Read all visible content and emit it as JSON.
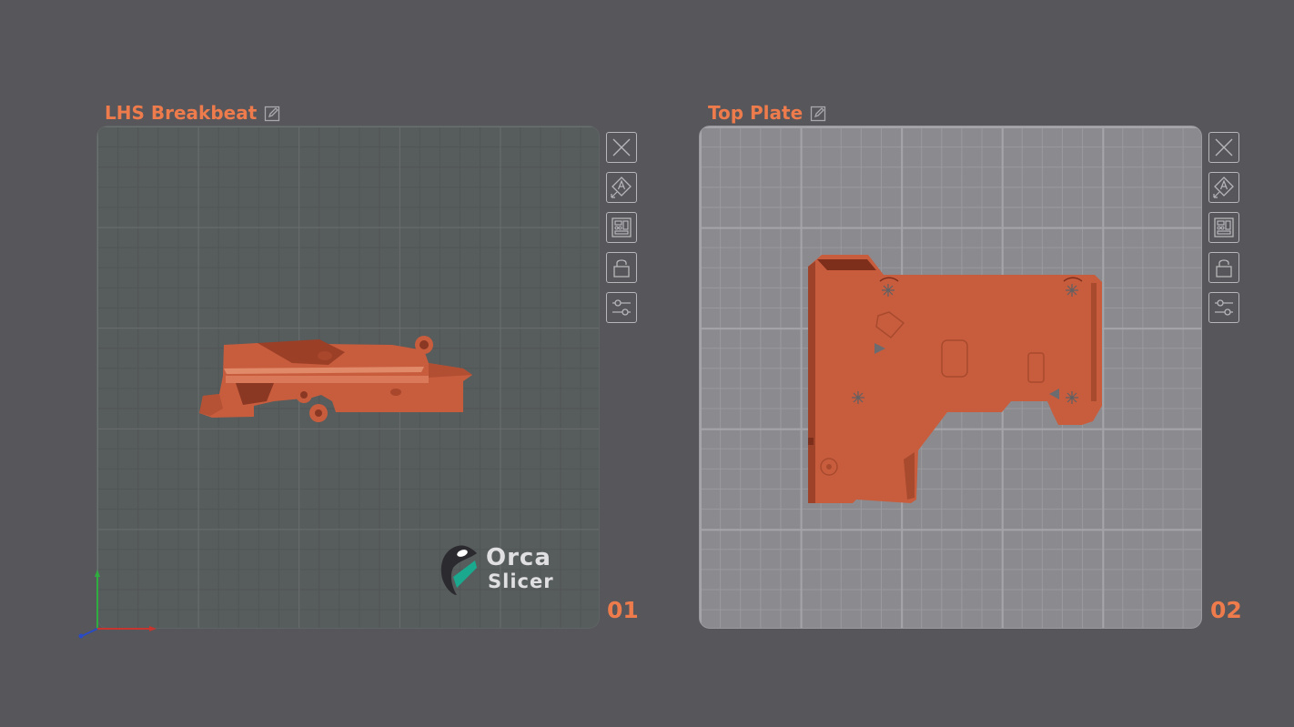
{
  "plates": [
    {
      "title": "LHS Breakbeat",
      "number": "01"
    },
    {
      "title": "Top Plate",
      "number": "02"
    }
  ],
  "logo": {
    "line1": "Orca",
    "line2": "Slicer"
  },
  "toolbar_icons": [
    "close-icon",
    "auto-orient-icon",
    "arrange-icon",
    "lock-icon",
    "settings-icon"
  ],
  "colors": {
    "background": "#56565b",
    "accent": "#ee7b4c",
    "model": "#c85d3e",
    "plate1_bed": "#575c5c",
    "plate2_bed": "#8b8b8f"
  }
}
